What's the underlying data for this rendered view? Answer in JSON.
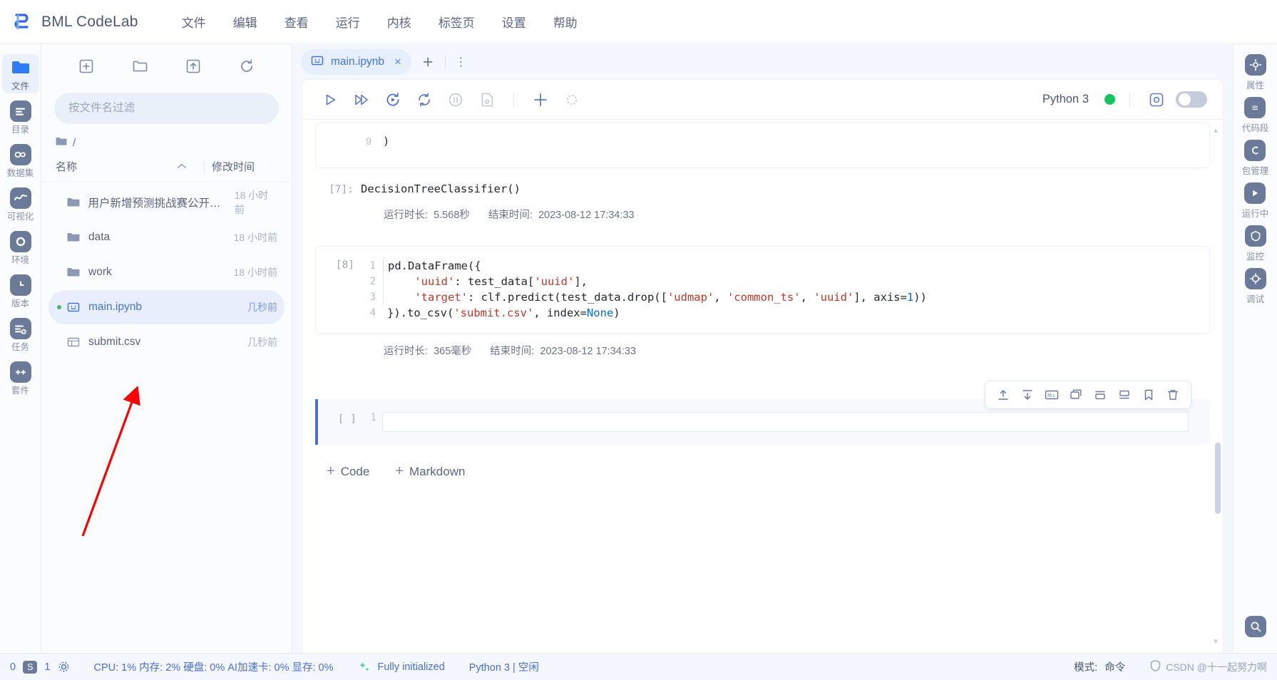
{
  "app": {
    "brand": "BML CodeLab",
    "logo_icon": "bml-logo-icon"
  },
  "menu": {
    "items": [
      {
        "label": "文件",
        "name": "menu-file"
      },
      {
        "label": "编辑",
        "name": "menu-edit"
      },
      {
        "label": "查看",
        "name": "menu-view"
      },
      {
        "label": "运行",
        "name": "menu-run"
      },
      {
        "label": "内核",
        "name": "menu-kernel"
      },
      {
        "label": "标签页",
        "name": "menu-tabs"
      },
      {
        "label": "设置",
        "name": "menu-settings"
      },
      {
        "label": "帮助",
        "name": "menu-help"
      }
    ]
  },
  "left_rail": {
    "items": [
      {
        "label": "文件",
        "icon": "folder-icon",
        "active": true
      },
      {
        "label": "目录",
        "icon": "list-icon",
        "active": false
      },
      {
        "label": "数据集",
        "icon": "dataset-icon",
        "active": false
      },
      {
        "label": "可视化",
        "icon": "chart-wave-icon",
        "active": false
      },
      {
        "label": "环境",
        "icon": "circle-dot-icon",
        "active": false
      },
      {
        "label": "版本",
        "icon": "clock-icon",
        "active": false
      },
      {
        "label": "任务",
        "icon": "task-add-icon",
        "active": false
      },
      {
        "label": "套件",
        "icon": "toolkit-icon",
        "active": false
      }
    ]
  },
  "file_panel": {
    "tools": [
      {
        "name": "new-file-button",
        "icon": "plus-square-icon"
      },
      {
        "name": "new-folder-button",
        "icon": "folder-plus-icon"
      },
      {
        "name": "upload-button",
        "icon": "upload-icon"
      },
      {
        "name": "refresh-button",
        "icon": "refresh-icon"
      }
    ],
    "search": {
      "placeholder": "按文件名过滤",
      "value": ""
    },
    "breadcrumb": "/",
    "columns": {
      "name": "名称",
      "modified": "修改时间"
    },
    "files": [
      {
        "name": "用户新增预测挑战赛公开数据",
        "modified": "18 小时前",
        "type": "folder",
        "selected": false,
        "running": false
      },
      {
        "name": "data",
        "modified": "18 小时前",
        "type": "folder",
        "selected": false,
        "running": false
      },
      {
        "name": "work",
        "modified": "18 小时前",
        "type": "folder",
        "selected": false,
        "running": false
      },
      {
        "name": "main.ipynb",
        "modified": "几秒前",
        "type": "notebook",
        "selected": true,
        "running": true
      },
      {
        "name": "submit.csv",
        "modified": "几秒前",
        "type": "csv",
        "selected": false,
        "running": false
      }
    ]
  },
  "notebook": {
    "tab": {
      "title": "main.ipynb",
      "icon": "notebook-icon",
      "close": "×"
    },
    "tab_add": "+",
    "tab_more": "⋮",
    "toolbar": {
      "buttons": [
        {
          "name": "run-cell-button",
          "icon": "play-icon"
        },
        {
          "name": "run-all-button",
          "icon": "fast-forward-icon"
        },
        {
          "name": "restart-run-button",
          "icon": "restart-run-icon"
        },
        {
          "name": "restart-kernel-button",
          "icon": "refresh-icon"
        },
        {
          "name": "interrupt-button",
          "icon": "pause-circle-icon"
        },
        {
          "name": "save-checkpoint-button",
          "icon": "save-doc-icon"
        },
        {
          "name": "insert-cell-button",
          "icon": "plus-icon"
        },
        {
          "name": "settings-button",
          "icon": "gear-outline-icon"
        }
      ],
      "kernel_name": "Python 3",
      "kernel_status_color": "#13c55c",
      "snapshot_icon": "snapshot-icon",
      "toggle_on": false
    },
    "cells": [
      {
        "id": "cell-6-tail",
        "prompt": "",
        "type": "code-tail",
        "lines": [
          {
            "no": "9",
            "text": ")"
          }
        ]
      },
      {
        "id": "cell-7-output",
        "prompt": "[7]:",
        "type": "output",
        "text": "DecisionTreeClassifier()",
        "run_label": "运行时长:",
        "run_value": "5.568秒",
        "end_label": "结束时间:",
        "end_value": "2023-08-12 17:34:33"
      },
      {
        "id": "cell-8",
        "prompt": "[8]",
        "type": "code",
        "lines": [
          {
            "no": "1",
            "text": "pd.DataFrame({"
          },
          {
            "no": "2",
            "text": "    'uuid': test_data['uuid'],"
          },
          {
            "no": "3",
            "text": "    'target': clf.predict(test_data.drop(['udmap', 'common_ts', 'uuid'], axis=1))"
          },
          {
            "no": "4",
            "text": "}).to_csv('submit.csv', index=None)"
          }
        ],
        "run_label": "运行时长:",
        "run_value": "365毫秒",
        "end_label": "结束时间:",
        "end_value": "2023-08-12 17:34:33"
      },
      {
        "id": "cell-empty",
        "prompt": "[ ]",
        "type": "empty",
        "lines": [
          {
            "no": "1",
            "text": ""
          }
        ]
      }
    ],
    "cell_tools": [
      {
        "name": "move-up-button",
        "icon": "move-up-icon"
      },
      {
        "name": "move-down-button",
        "icon": "move-down-icon"
      },
      {
        "name": "to-markdown-button",
        "icon": "markdown-icon"
      },
      {
        "name": "duplicate-button",
        "icon": "duplicate-icon"
      },
      {
        "name": "insert-above-button",
        "icon": "insert-above-icon"
      },
      {
        "name": "insert-below-button",
        "icon": "insert-below-icon"
      },
      {
        "name": "bookmark-button",
        "icon": "bookmark-icon"
      },
      {
        "name": "delete-cell-button",
        "icon": "trash-icon"
      }
    ],
    "add_buttons": [
      {
        "label": "Code",
        "name": "add-code-button"
      },
      {
        "label": "Markdown",
        "name": "add-markdown-button"
      }
    ]
  },
  "right_rail": {
    "items": [
      {
        "label": "属性",
        "icon": "properties-icon"
      },
      {
        "label": "代码段",
        "icon": "snippet-icon"
      },
      {
        "label": "包管理",
        "icon": "package-icon"
      },
      {
        "label": "运行中",
        "icon": "running-icon"
      },
      {
        "label": "监控",
        "icon": "monitor-icon"
      },
      {
        "label": "调试",
        "icon": "debug-icon"
      }
    ],
    "bottom": {
      "name": "help-search-icon",
      "label": ""
    }
  },
  "statusbar": {
    "left_counts": [
      "0",
      "1"
    ],
    "badge": "S",
    "settings_icon": "gear-icon",
    "resources": "CPU: 1% 内存: 2% 硬盘: 0% AI加速卡: 0% 显存: 0%",
    "kernel_state_icon": "sparkle-icon",
    "kernel_state": "Fully initialized",
    "kernel_info": "Python 3 | 空闲",
    "mode_label": "模式:",
    "mode_value": "命令",
    "watermark": "CSDN @十一起努力啊"
  }
}
